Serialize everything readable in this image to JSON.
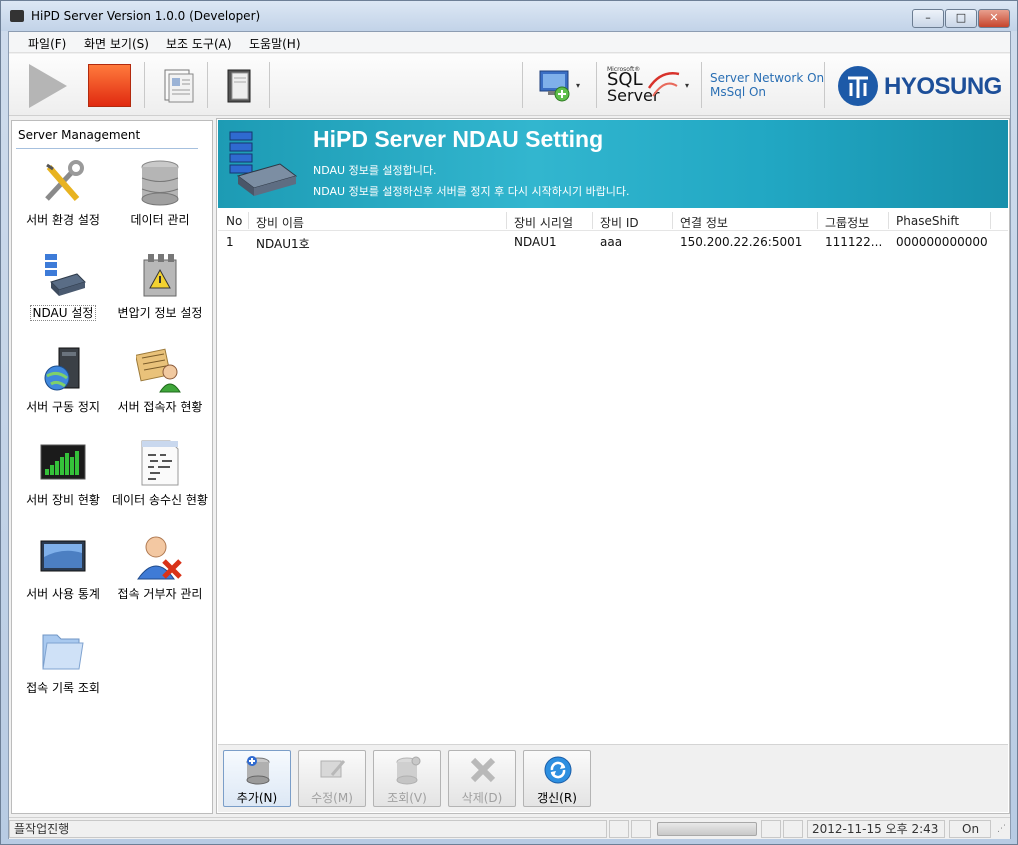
{
  "window": {
    "title": "HiPD Server Version 1.0.0 (Developer)",
    "controls": {
      "minimize": "–",
      "maximize": "□",
      "close": "✕"
    }
  },
  "menu": [
    "파일(F)",
    "화면 보기(S)",
    "보조 도구(A)",
    "도움말(H)"
  ],
  "toolbar": {
    "sql_small": "Microsoft®",
    "sql_line1": "SQL",
    "sql_line2": "Server",
    "status_line1": "Server Network On",
    "status_line2": "MsSql On",
    "logo_text": "HYOSUNG",
    "dropdown_glyph": "▾",
    "icons": [
      "play-icon",
      "stop-icon",
      "report-document-icon",
      "book-icon",
      "network-computer-icon",
      "sql-server-icon",
      "hyosung-logo"
    ]
  },
  "sidebar": {
    "title": "Server Management",
    "items": [
      {
        "label": "서버 환경 설정",
        "icon": "tools-wrench-icon"
      },
      {
        "label": "데이터 관리",
        "icon": "database-icon"
      },
      {
        "label": "NDAU 설정",
        "icon": "ndau-device-icon",
        "selected": true
      },
      {
        "label": "변압기 정보 설정",
        "icon": "transformer-icon"
      },
      {
        "label": "서버 구동 정지",
        "icon": "server-globe-icon"
      },
      {
        "label": "서버 접속자 현황",
        "icon": "user-connection-icon"
      },
      {
        "label": "서버 장비 현황",
        "icon": "equipment-chart-icon"
      },
      {
        "label": "데이터 송수신 현황",
        "icon": "data-binary-icon"
      },
      {
        "label": "서버 사용 통계",
        "icon": "usage-screen-icon"
      },
      {
        "label": "접속 거부자 관리",
        "icon": "denied-user-icon"
      },
      {
        "label": "접속 기록 조회",
        "icon": "folder-icon"
      }
    ]
  },
  "banner": {
    "title": "HiPD Server NDAU Setting",
    "line1": "NDAU 정보를 설정합니다.",
    "line2": "NDAU 정보를 설정하신후 서버를 정지 후 다시 시작하시기 바랍니다."
  },
  "table": {
    "columns": [
      "No",
      "장비 이름",
      "장비 시리얼",
      "장비 ID",
      "연결 정보",
      "그룹정보",
      "PhaseShift"
    ],
    "rows": [
      [
        "1",
        "NDAU1호",
        "NDAU1",
        "aaa",
        "150.200.22.26:5001",
        "111122...",
        "000000000000"
      ]
    ]
  },
  "actions": [
    {
      "label": "추가(N)",
      "enabled": true,
      "icon": "add-database-icon"
    },
    {
      "label": "수정(M)",
      "enabled": false,
      "icon": "edit-icon"
    },
    {
      "label": "조회(V)",
      "enabled": false,
      "icon": "view-database-icon"
    },
    {
      "label": "삭제(D)",
      "enabled": false,
      "icon": "delete-x-icon"
    },
    {
      "label": "갱신(R)",
      "enabled": true,
      "icon": "refresh-icon"
    }
  ],
  "statusbar": {
    "message": "플작업진행",
    "datetime": "2012-11-15 오후 2:43",
    "state": "On"
  },
  "colors": {
    "banner": "#21a7c3",
    "accent_text": "#2a6fb4",
    "logo": "#1d4f99"
  }
}
